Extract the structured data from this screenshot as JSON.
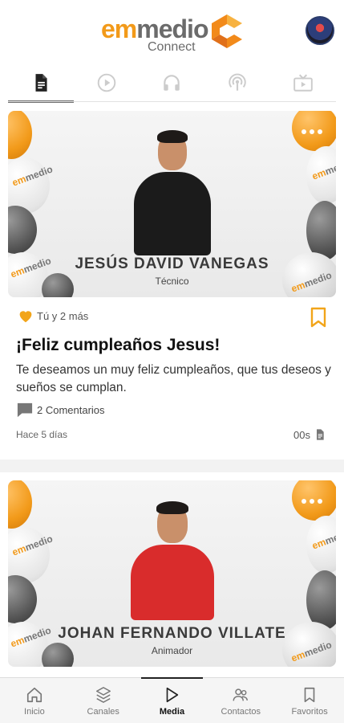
{
  "header": {
    "logo_em": "em",
    "logo_medio": "medio",
    "logo_sub": "Connect",
    "brand_color": "#f29a1a"
  },
  "tabs": [
    {
      "icon": "document-icon",
      "active": true
    },
    {
      "icon": "play-circle-icon",
      "active": false
    },
    {
      "icon": "headphones-icon",
      "active": false
    },
    {
      "icon": "podcast-icon",
      "active": false
    },
    {
      "icon": "tv-icon",
      "active": false
    }
  ],
  "posts": [
    {
      "person_name": "JESÚS DAVID VANEGAS",
      "person_role": "Técnico",
      "likes": "Tú y 2 más",
      "title": "¡Feliz cumpleaños Jesus!",
      "body": "Te deseamos un muy feliz cumpleaños, que tus deseos y sueños se cumplan.",
      "comments": "2 Comentarios",
      "time_ago": "Hace 5 días",
      "read_time": "00s"
    },
    {
      "person_name": "JOHAN FERNANDO VILLATE",
      "person_role": "Animador"
    }
  ],
  "mini_logo": {
    "em": "em",
    "medio": "medio"
  },
  "bottom_nav": [
    {
      "label": "Inicio",
      "icon": "home-icon",
      "active": false
    },
    {
      "label": "Canales",
      "icon": "channels-icon",
      "active": false
    },
    {
      "label": "Media",
      "icon": "play-icon",
      "active": true
    },
    {
      "label": "Contactos",
      "icon": "contacts-icon",
      "active": false
    },
    {
      "label": "Favoritos",
      "icon": "bookmark-icon",
      "active": false
    }
  ]
}
